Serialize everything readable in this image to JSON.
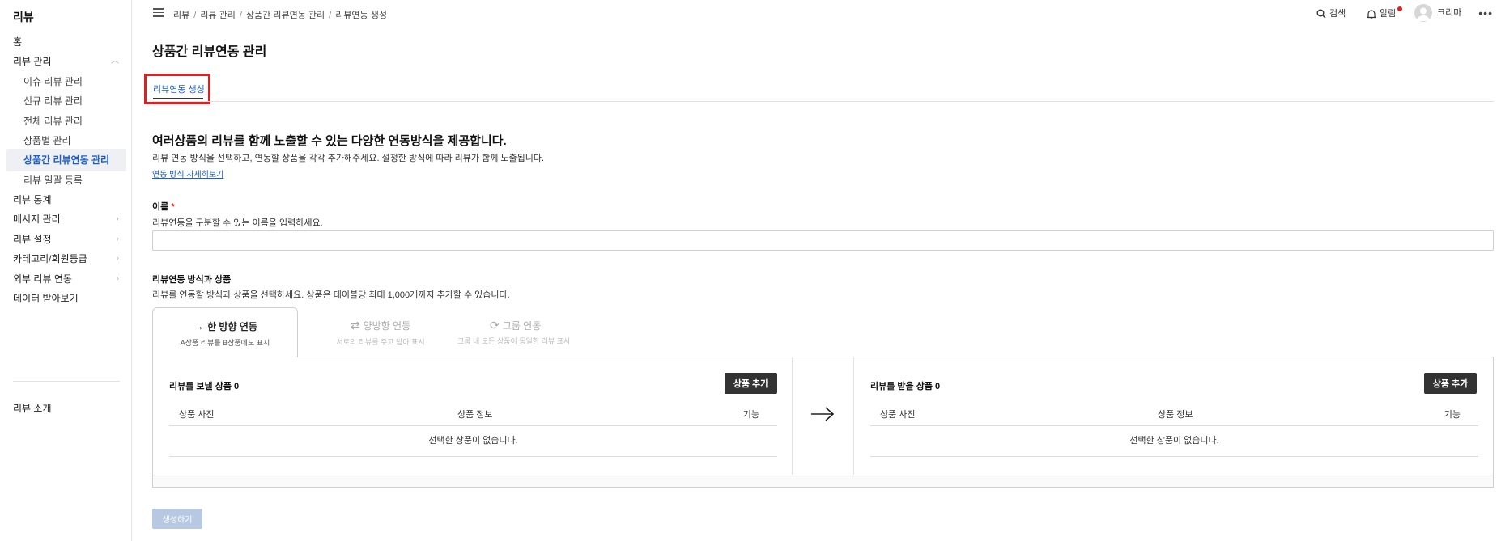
{
  "sidebar": {
    "title": "리뷰",
    "items": [
      {
        "label": "홈"
      },
      {
        "label": "리뷰 관리"
      },
      {
        "label": "이슈 리뷰 관리"
      },
      {
        "label": "신규 리뷰 관리"
      },
      {
        "label": "전체 리뷰 관리"
      },
      {
        "label": "상품별 관리"
      },
      {
        "label": "상품간 리뷰연동 관리"
      },
      {
        "label": "리뷰 일괄 등록"
      },
      {
        "label": "리뷰 통계"
      },
      {
        "label": "메시지 관리"
      },
      {
        "label": "리뷰 설정"
      },
      {
        "label": "카테고리/회원등급"
      },
      {
        "label": "외부 리뷰 연동"
      },
      {
        "label": "데이터 받아보기"
      },
      {
        "label": "리뷰 소개"
      }
    ]
  },
  "topbar": {
    "breadcrumb": [
      "리뷰",
      "리뷰 관리",
      "상품간 리뷰연동 관리",
      "리뷰연동 생성"
    ],
    "search_label": "검색",
    "notify_label": "알림",
    "user_label": "크리마",
    "more": "•••"
  },
  "page": {
    "title": "상품간 리뷰연동 관리",
    "tab_label": "리뷰연동 생성"
  },
  "intro": {
    "heading": "여러상품의 리뷰를 함께 노출할 수 있는 다양한 연동방식을 제공합니다.",
    "desc": "리뷰 연동 방식을 선택하고, 연동할 상품을 각각 추가해주세요. 설정한 방식에 따라 리뷰가 함께 노출됩니다.",
    "link": "연동 방식 자세히보기"
  },
  "name_field": {
    "label": "이름",
    "required_mark": "*",
    "help": "리뷰연동을 구분할 수 있는 이름을 입력하세요.",
    "value": "",
    "placeholder": ""
  },
  "method": {
    "label": "리뷰연동 방식과 상품",
    "help": "리뷰를 연동할 방식과 상품을 선택하세요. 상품은 테이블당 최대 1,000개까지 추가할 수 있습니다.",
    "tabs": [
      {
        "title": "한 방향 연동",
        "desc": "A상품 리뷰를 B상품에도 표시"
      },
      {
        "title": "양방향 연동",
        "desc": "서로의 리뷰를 주고 받아 표시"
      },
      {
        "title": "그룹 연동",
        "desc": "그룹 내 모든 상품이 동일한 리뷰 표시"
      }
    ]
  },
  "panel": {
    "left": {
      "title": "리뷰를 보낼 상품 0",
      "add_label": "상품 추가",
      "empty": "선택한 상품이 없습니다."
    },
    "right": {
      "title": "리뷰를 받을 상품 0",
      "add_label": "상품 추가",
      "empty": "선택한 상품이 없습니다."
    },
    "columns": [
      "상품 사진",
      "상품 정보",
      "기능"
    ]
  },
  "create_label": "생성하기"
}
